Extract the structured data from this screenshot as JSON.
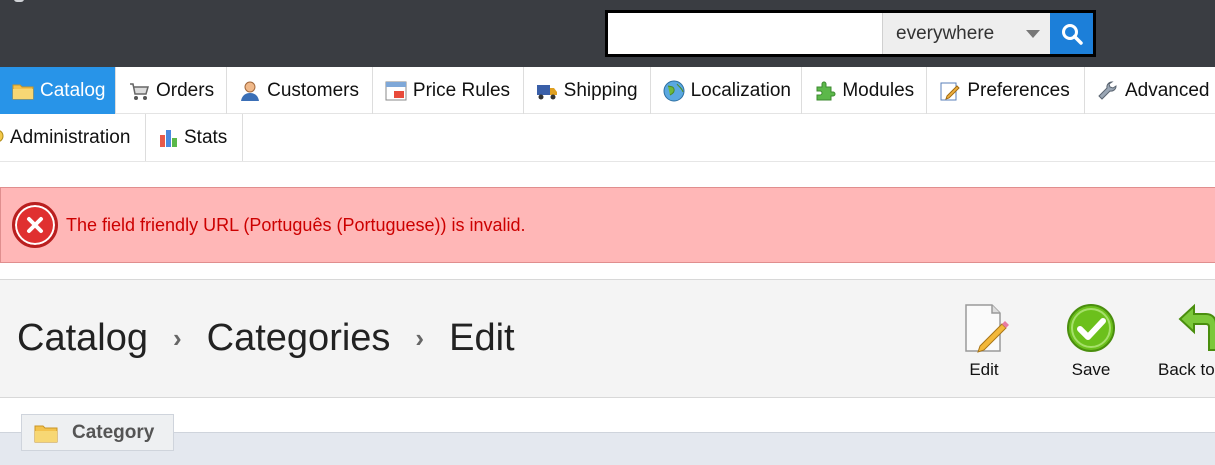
{
  "header": {
    "search_value": "",
    "search_scope": "everywhere"
  },
  "menu": {
    "row1": [
      {
        "label": "Catalog",
        "icon": "folder-icon",
        "active": true
      },
      {
        "label": "Orders",
        "icon": "cart-icon"
      },
      {
        "label": "Customers",
        "icon": "user-icon"
      },
      {
        "label": "Price Rules",
        "icon": "price-tag-icon"
      },
      {
        "label": "Shipping",
        "icon": "truck-icon"
      },
      {
        "label": "Localization",
        "icon": "globe-icon"
      },
      {
        "label": "Modules",
        "icon": "puzzle-icon"
      },
      {
        "label": "Preferences",
        "icon": "edit-pen-icon"
      },
      {
        "label": "Advanced",
        "icon": "wrench-icon"
      }
    ],
    "row2": [
      {
        "label": "Administration",
        "icon": "key-icon"
      },
      {
        "label": "Stats",
        "icon": "bar-chart-icon"
      }
    ]
  },
  "error": {
    "message": "The field friendly URL (Português (Portuguese)) is invalid."
  },
  "breadcrumb": {
    "items": [
      "Catalog",
      "Categories",
      "Edit"
    ],
    "separator": "›"
  },
  "toolbar": {
    "edit_label": "Edit",
    "save_label": "Save",
    "back_label": "Back to"
  },
  "category_tab": {
    "label": "Category",
    "icon": "folder-icon"
  },
  "colors": {
    "header_bg": "#3a3d42",
    "active_menu": "#2894e8",
    "error_bg": "#ffb7b7",
    "error_text": "#cc0000",
    "save_green": "#6cc01c"
  }
}
